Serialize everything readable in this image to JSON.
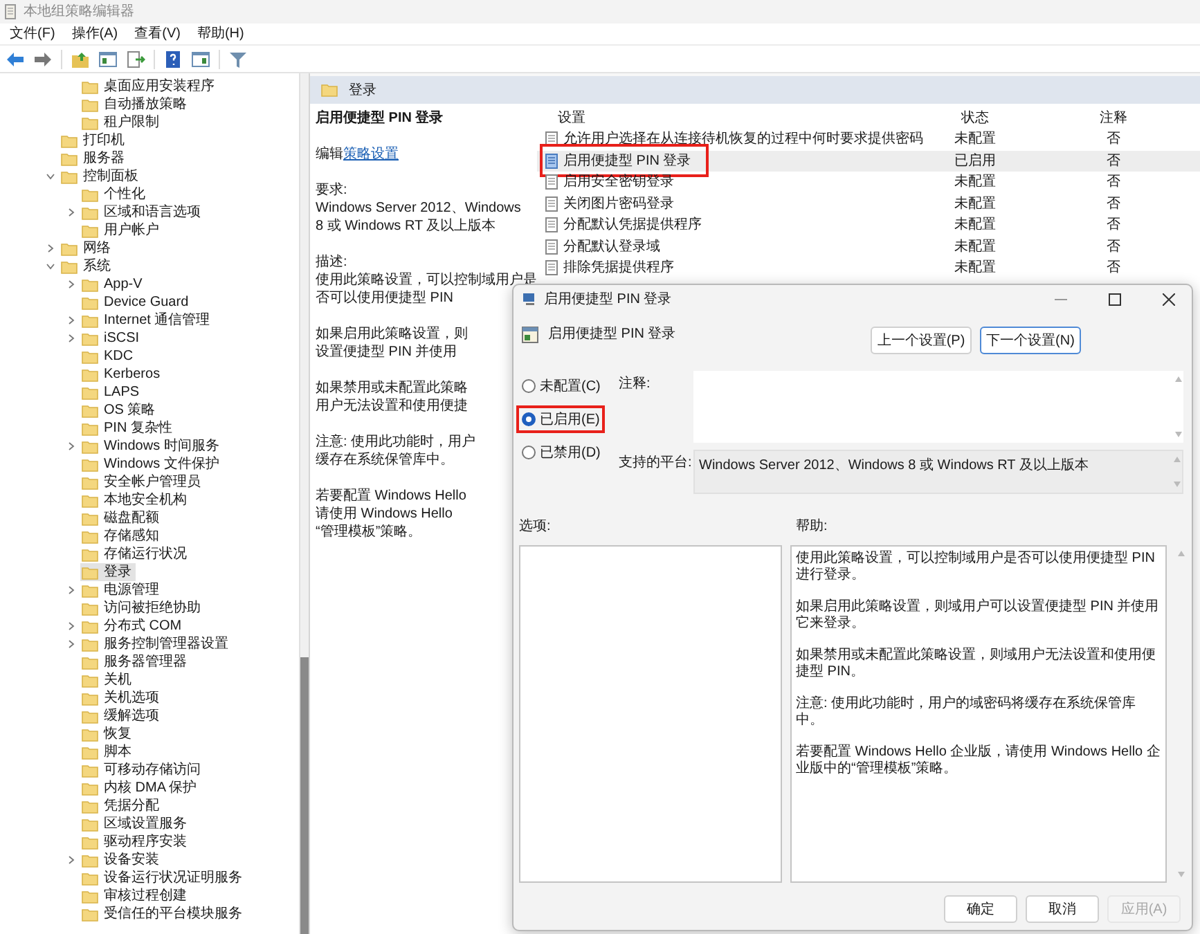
{
  "window": {
    "title": "本地组策略编辑器"
  },
  "menu": [
    "文件(F)",
    "操作(A)",
    "查看(V)",
    "帮助(H)"
  ],
  "tree": {
    "continued": [
      {
        "label": "桌面应用安装程序",
        "selected": false
      },
      {
        "label": "自动播放策略",
        "selected": false
      },
      {
        "label": "租户限制",
        "selected": false
      }
    ],
    "items": [
      {
        "label": "打印机",
        "selected": false
      },
      {
        "label": "服务器",
        "selected": false
      },
      {
        "label": "控制面板",
        "selected": false,
        "expanded": true,
        "children": [
          {
            "label": "个性化",
            "selected": false
          },
          {
            "label": "区域和语言选项",
            "selected": false,
            "expanded": false
          },
          {
            "label": "用户帐户",
            "selected": false
          }
        ]
      },
      {
        "label": "网络",
        "selected": false,
        "expanded": false
      },
      {
        "label": "系统",
        "selected": false,
        "expanded": true,
        "children": [
          {
            "label": "App-V",
            "selected": false,
            "expanded": false
          },
          {
            "label": "Device Guard",
            "selected": false
          },
          {
            "label": "Internet 通信管理",
            "selected": false,
            "expanded": false
          },
          {
            "label": "iSCSI",
            "selected": false,
            "expanded": false
          },
          {
            "label": "KDC",
            "selected": false
          },
          {
            "label": "Kerberos",
            "selected": false
          },
          {
            "label": "LAPS",
            "selected": false
          },
          {
            "label": "OS 策略",
            "selected": false
          },
          {
            "label": "PIN 复杂性",
            "selected": false
          },
          {
            "label": "Windows 时间服务",
            "selected": false,
            "expanded": false
          },
          {
            "label": "Windows 文件保护",
            "selected": false
          },
          {
            "label": "安全帐户管理员",
            "selected": false
          },
          {
            "label": "本地安全机构",
            "selected": false
          },
          {
            "label": "磁盘配额",
            "selected": false
          },
          {
            "label": "存储感知",
            "selected": false
          },
          {
            "label": "存储运行状况",
            "selected": false
          },
          {
            "label": "登录",
            "selected": true
          },
          {
            "label": "电源管理",
            "selected": false,
            "expanded": false
          },
          {
            "label": "访问被拒绝协助",
            "selected": false
          },
          {
            "label": "分布式 COM",
            "selected": false,
            "expanded": false
          },
          {
            "label": "服务控制管理器设置",
            "selected": false,
            "expanded": false
          },
          {
            "label": "服务器管理器",
            "selected": false
          },
          {
            "label": "关机",
            "selected": false
          },
          {
            "label": "关机选项",
            "selected": false
          },
          {
            "label": "缓解选项",
            "selected": false
          },
          {
            "label": "恢复",
            "selected": false
          },
          {
            "label": "脚本",
            "selected": false
          },
          {
            "label": "可移动存储访问",
            "selected": false
          },
          {
            "label": "内核 DMA 保护",
            "selected": false
          },
          {
            "label": "凭据分配",
            "selected": false
          },
          {
            "label": "区域设置服务",
            "selected": false
          },
          {
            "label": "驱动程序安装",
            "selected": false
          },
          {
            "label": "设备安装",
            "selected": false,
            "expanded": false
          },
          {
            "label": "设备运行状况证明服务",
            "selected": false
          },
          {
            "label": "审核过程创建",
            "selected": false
          },
          {
            "label": "受信任的平台模块服务",
            "selected": false
          }
        ]
      }
    ]
  },
  "details": {
    "folder": "登录",
    "policy_title": "启用便捷型 PIN 登录",
    "edit_prefix": "编辑",
    "edit_link": "策略设置",
    "paragraphs": [
      [
        "要求:",
        "Windows Server 2012、Windows",
        "8 或 Windows RT 及以上版本"
      ],
      [
        "描述:",
        "使用此策略设置，可以控制域用户是",
        "否可以使用便捷型 PIN"
      ],
      [
        "如果启用此策略设置，则",
        "设置便捷型 PIN 并使用"
      ],
      [
        "如果禁用或未配置此策略",
        "用户无法设置和使用便捷"
      ],
      [
        "注意: 使用此功能时，用户",
        "缓存在系统保管库中。"
      ],
      [
        "若要配置 Windows Hello",
        "请使用 Windows Hello",
        "“管理模板”策略。"
      ]
    ]
  },
  "settings": {
    "columns": [
      "设置",
      "状态",
      "注释"
    ],
    "rows": [
      {
        "name": "允许用户选择在从连接待机恢复的过程中何时要求提供密码",
        "state": "未配置",
        "comment": "否",
        "selected": false,
        "highlighted": false
      },
      {
        "name": "启用便捷型 PIN 登录",
        "state": "已启用",
        "comment": "否",
        "selected": true,
        "highlighted": true
      },
      {
        "name": "启用安全密钥登录",
        "state": "未配置",
        "comment": "否",
        "selected": false,
        "highlighted": false
      },
      {
        "name": "关闭图片密码登录",
        "state": "未配置",
        "comment": "否",
        "selected": false,
        "highlighted": false
      },
      {
        "name": "分配默认凭据提供程序",
        "state": "未配置",
        "comment": "否",
        "selected": false,
        "highlighted": false
      },
      {
        "name": "分配默认登录域",
        "state": "未配置",
        "comment": "否",
        "selected": false,
        "highlighted": false
      },
      {
        "name": "排除凭据提供程序",
        "state": "未配置",
        "comment": "否",
        "selected": false,
        "highlighted": false
      }
    ]
  },
  "dialog": {
    "title": "启用便捷型 PIN 登录",
    "heading": "启用便捷型 PIN 登录",
    "nav_buttons": [
      {
        "label": "上一个设置(P)",
        "focused": false
      },
      {
        "label": "下一个设置(N)",
        "focused": true
      }
    ],
    "options": [
      {
        "label": "未配置(C)",
        "selected": false,
        "highlighted": false
      },
      {
        "label": "已启用(E)",
        "selected": true,
        "highlighted": true
      },
      {
        "label": "已禁用(D)",
        "selected": false,
        "highlighted": false
      }
    ],
    "comment_label": "注释:",
    "platform_label": "支持的平台:",
    "platform": "Windows Server 2012、Windows 8 或 Windows RT 及以上版本",
    "options_label": "选项:",
    "help_label": "帮助:",
    "help": [
      "使用此策略设置，可以控制域用户是否可以使用便捷型 PIN 进行登录。",
      "如果启用此策略设置，则域用户可以设置便捷型 PIN 并使用它来登录。",
      "如果禁用或未配置此策略设置，则域用户无法设置和使用便捷型 PIN。",
      "注意: 使用此功能时，用户的域密码将缓存在系统保管库中。",
      "若要配置 Windows Hello 企业版，请使用 Windows Hello 企业版中的“管理模板”策略。"
    ],
    "footer_buttons": [
      {
        "label": "确定",
        "disabled": false
      },
      {
        "label": "取消",
        "disabled": false
      },
      {
        "label": "应用(A)",
        "disabled": true
      }
    ]
  }
}
